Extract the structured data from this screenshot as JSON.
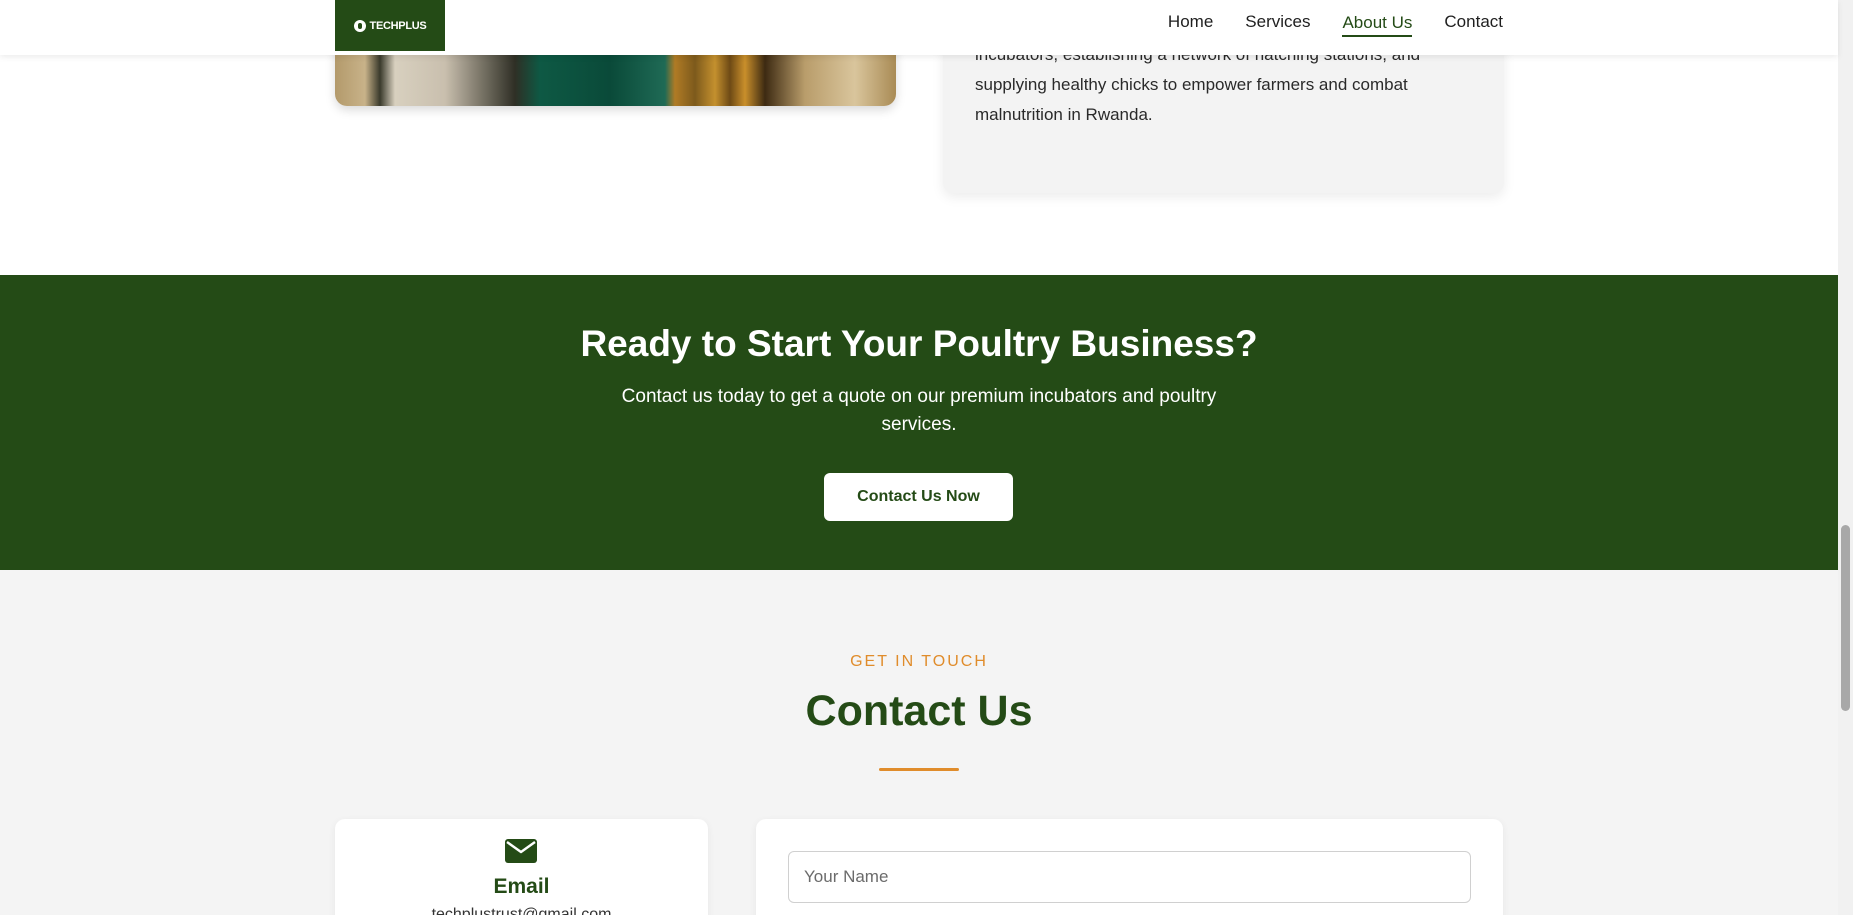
{
  "header": {
    "logo_text": "TECHPLUS",
    "nav": [
      {
        "label": "Home"
      },
      {
        "label": "Services"
      },
      {
        "label": "About Us",
        "active": true
      },
      {
        "label": "Contact"
      }
    ]
  },
  "about": {
    "text": "incubators, establishing a network of hatching stations, and supplying healthy chicks to empower farmers and combat malnutrition in Rwanda."
  },
  "cta": {
    "title": "Ready to Start Your Poultry Business?",
    "text": "Contact us today to get a quote on our premium incubators and poultry services.",
    "button_label": "Contact Us Now"
  },
  "contact": {
    "eyebrow": "GET IN TOUCH",
    "title": "Contact Us",
    "email_card": {
      "icon": "envelope-icon",
      "title": "Email",
      "value": "techplustrust@gmail.com"
    },
    "form": {
      "name_placeholder": "Your Name"
    }
  },
  "colors": {
    "brand_green": "#244b16",
    "accent_orange": "#e08c2b",
    "section_gray": "#f4f4f4"
  }
}
